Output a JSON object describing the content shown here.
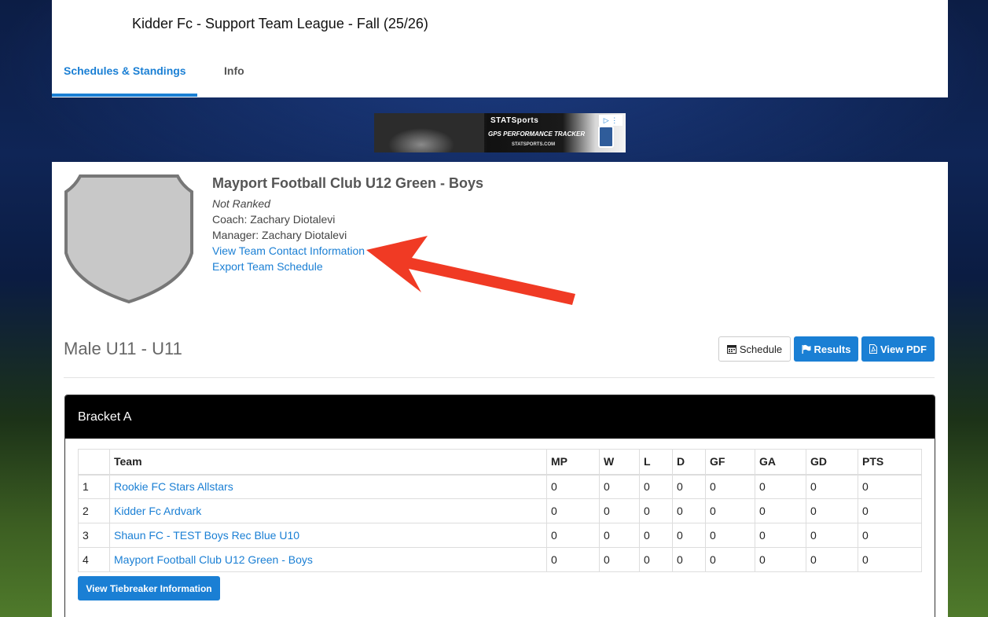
{
  "header": {
    "league_title": "Kidder Fc - Support Team League - Fall (25/26)",
    "tabs": [
      {
        "label": "Schedules & Standings",
        "active": true
      },
      {
        "label": "Info",
        "active": false
      }
    ]
  },
  "ad": {
    "brand": "STATSports",
    "tagline": "GPS PERFORMANCE TRACKER",
    "url": "STATSPORTS.COM"
  },
  "team": {
    "name": "Mayport Football Club U12 Green - Boys",
    "ranking": "Not Ranked",
    "coach": "Coach: Zachary Diotalevi",
    "manager": "Manager: Zachary Diotalevi",
    "contact_link": "View Team Contact Information",
    "export_link": "Export Team Schedule"
  },
  "division": {
    "title": "Male U11 - U11",
    "buttons": {
      "schedule": "Schedule",
      "results": "Results",
      "pdf": "View PDF"
    }
  },
  "bracket": {
    "name": "Bracket A",
    "columns": [
      "",
      "Team",
      "MP",
      "W",
      "L",
      "D",
      "GF",
      "GA",
      "GD",
      "PTS"
    ],
    "rows": [
      {
        "rank": "1",
        "team": "Rookie FC Stars Allstars",
        "mp": "0",
        "w": "0",
        "l": "0",
        "d": "0",
        "gf": "0",
        "ga": "0",
        "gd": "0",
        "pts": "0"
      },
      {
        "rank": "2",
        "team": "Kidder Fc Ardvark",
        "mp": "0",
        "w": "0",
        "l": "0",
        "d": "0",
        "gf": "0",
        "ga": "0",
        "gd": "0",
        "pts": "0"
      },
      {
        "rank": "3",
        "team": "Shaun FC - TEST Boys Rec Blue U10",
        "mp": "0",
        "w": "0",
        "l": "0",
        "d": "0",
        "gf": "0",
        "ga": "0",
        "gd": "0",
        "pts": "0"
      },
      {
        "rank": "4",
        "team": "Mayport Football Club U12 Green - Boys",
        "mp": "0",
        "w": "0",
        "l": "0",
        "d": "0",
        "gf": "0",
        "ga": "0",
        "gd": "0",
        "pts": "0"
      }
    ],
    "tiebreaker_button": "View Tiebreaker Information"
  },
  "colors": {
    "accent": "#1a7fd4",
    "annotation_arrow": "#f03a24",
    "bracket_header": "#000000"
  },
  "icons": [
    "calendar-icon",
    "flag-icon",
    "pdf-file-icon",
    "team-shield-placeholder-icon"
  ]
}
